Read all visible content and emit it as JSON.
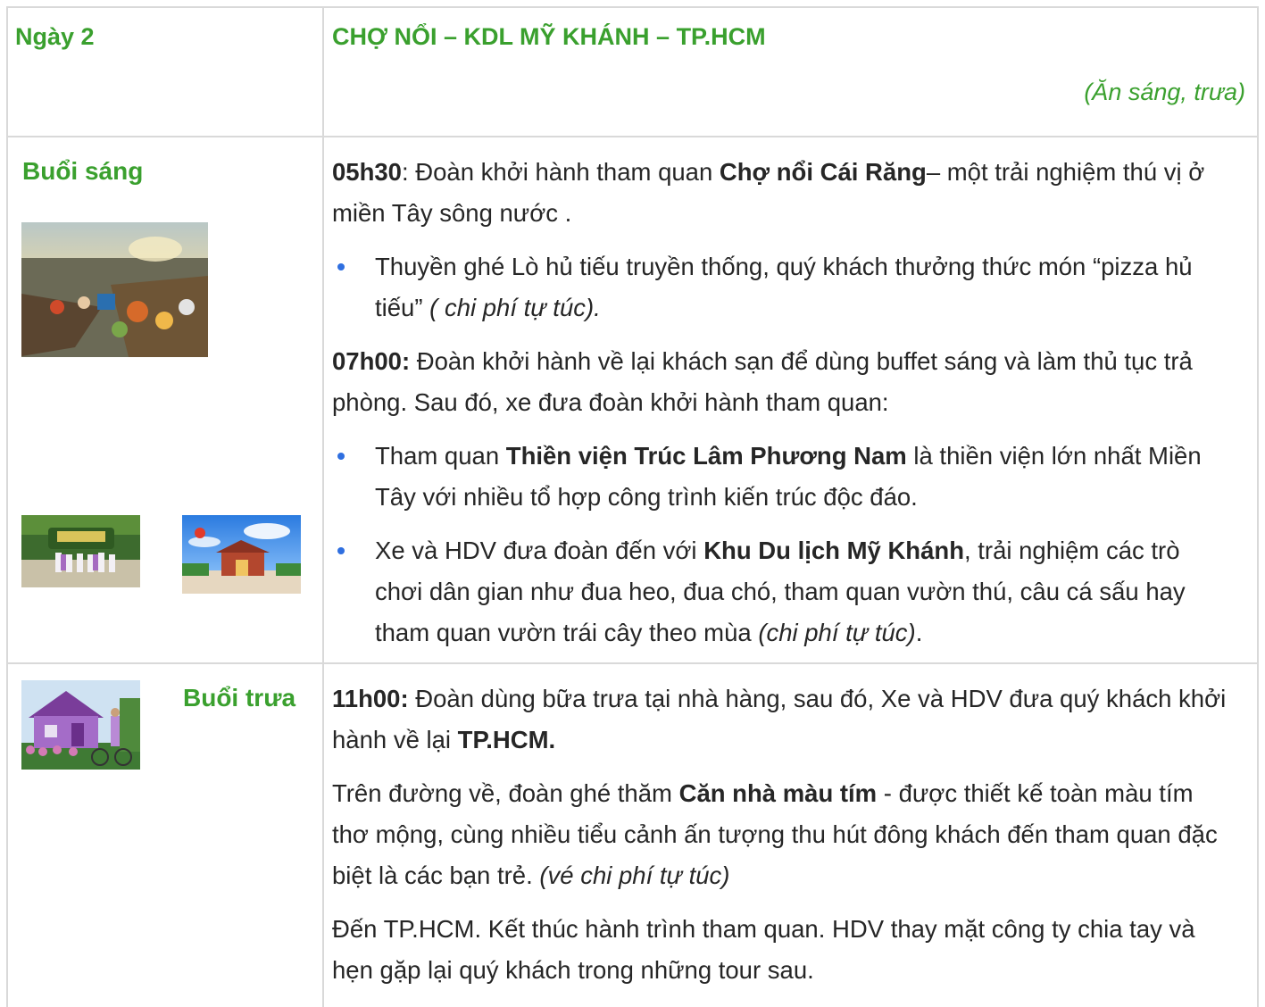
{
  "header": {
    "day_label": "Ngày 2",
    "title": "CHỢ NỔI – KDL MỸ KHÁNH – TP.HCM",
    "meals": "(Ăn sáng, trưa)"
  },
  "morning": {
    "label": "Buổi sáng",
    "p1": {
      "time": "05h30",
      "text_a": ": Đoàn khởi hành tham quan ",
      "place": "Chợ nổi Cái Răng",
      "text_b": "– một trải nghiệm thú vị ở miền Tây sông nước ."
    },
    "bullet1": {
      "text": "Thuyền ghé Lò hủ tiếu truyền thống, quý khách thưởng thức món   “pizza hủ tiếu”   ",
      "note": "( chi phí tự túc)."
    },
    "p2": {
      "time": "07h00:",
      "text": " Đoàn khởi hành về lại khách sạn để dùng buffet sáng và làm thủ tục trả phòng. Sau đó, xe đưa đoàn khởi hành tham quan:"
    },
    "bullet2": {
      "text_a": "Tham quan ",
      "place": "Thiền viện Trúc Lâm Phương Nam",
      "text_b": " là thiền viện lớn nhất Miền Tây với nhiều tổ hợp công trình kiến trúc độc đáo."
    },
    "bullet3": {
      "text_a": "Xe và HDV đưa đoàn đến với ",
      "place": "Khu Du lịch Mỹ Khánh",
      "text_b": ", trải nghiệm các trò chơi dân gian như đua heo, đua chó, tham quan vườn thú, câu cá sấu hay tham quan vườn trái cây theo mùa ",
      "note": "(chi phí tự túc)",
      "text_c": "."
    },
    "images": {
      "floating_market": "floating-market-photo",
      "my_khanh_gate": "my-khanh-gate-photo",
      "zen_monastery": "zen-monastery-photo"
    }
  },
  "noon": {
    "label": "Buổi trưa",
    "p1": {
      "time": "11h00:",
      "text": " Đoàn dùng bữa trưa tại nhà hàng, sau đó, Xe và HDV đưa quý khách khởi hành về lại ",
      "place": "TP.HCM."
    },
    "p2": {
      "text_a": "Trên đường về, đoàn ghé thăm ",
      "place": "Căn nhà màu tím",
      "text_b": " - được thiết kế toàn màu tím thơ mộng, cùng nhiều tiểu cảnh ấn tượng thu hút đông khách đến tham quan đặc biệt là các bạn trẻ. ",
      "note": "(vé chi phí tự túc)"
    },
    "p3": "Đến TP.HCM. Kết thúc hành trình tham quan. HDV thay mặt công ty chia tay và hẹn gặp lại quý khách trong những tour sau.",
    "images": {
      "purple_house": "purple-house-photo"
    }
  },
  "colors": {
    "accent_green": "#3aa02e",
    "bullet_blue": "#2f6fe0",
    "border": "#d9d9d9",
    "text": "#262626"
  }
}
